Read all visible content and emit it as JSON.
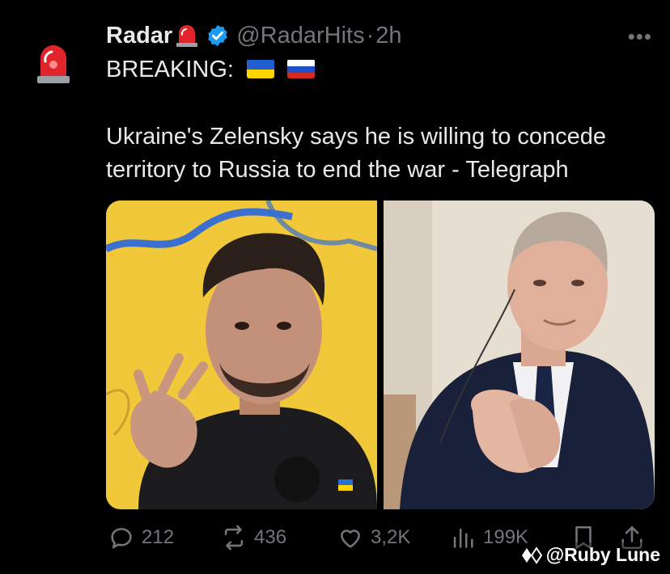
{
  "tweet": {
    "display_name": "Radar",
    "name_emoji": "siren-emoji",
    "handle": "@RadarHits",
    "separator": "·",
    "time": "2h",
    "more_glyph": "•••",
    "breaking_label": "BREAKING:",
    "flags": [
      "ukraine-flag",
      "russia-flag"
    ],
    "body_line1": "Ukraine's Zelensky says he is willing to concede",
    "body_line2": "territory to Russia to end the war - Telegraph",
    "media": {
      "left_image": "zelensky-photo",
      "right_image": "putin-photo"
    },
    "actions": {
      "replies": "212",
      "reposts": "436",
      "likes": "3,2K",
      "views": "199K"
    }
  },
  "watermark": {
    "text": "@Ruby Lune"
  },
  "colors": {
    "background": "#000000",
    "text": "#e7e9ea",
    "muted": "#71767b",
    "verified": "#1d9bf0",
    "siren": "#e0242b"
  }
}
